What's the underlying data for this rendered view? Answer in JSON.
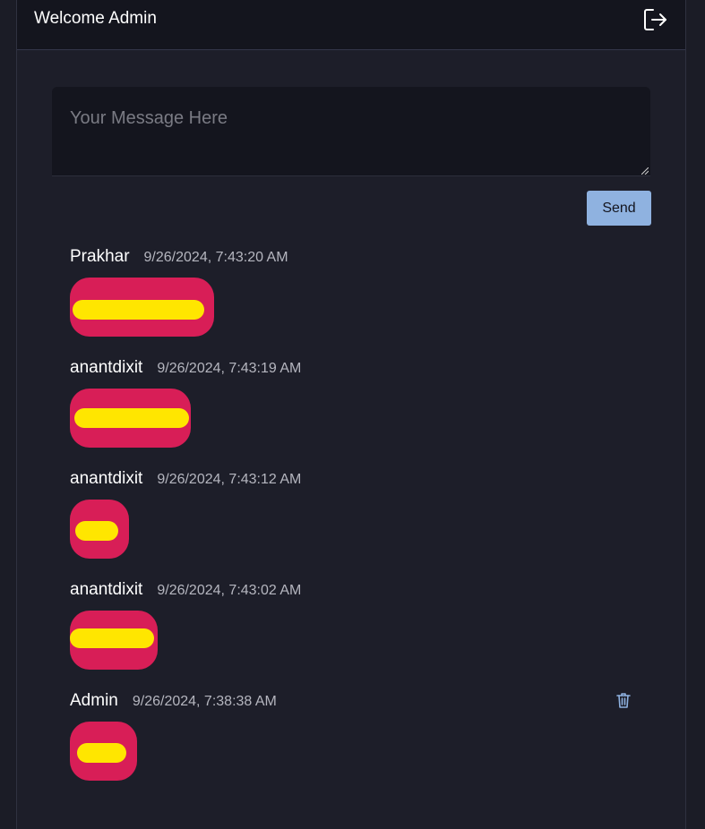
{
  "header": {
    "title": "Welcome Admin",
    "logout_icon": "logout-icon"
  },
  "composer": {
    "placeholder": "Your Message Here",
    "value": "",
    "send_label": "Send"
  },
  "messages": [
    {
      "user": "Prakhar",
      "time": "9/26/2024, 7:43:20 AM",
      "text": "",
      "deletable": false
    },
    {
      "user": "anantdixit",
      "time": "9/26/2024, 7:43:19 AM",
      "text": "",
      "deletable": false
    },
    {
      "user": "anantdixit",
      "time": "9/26/2024, 7:43:12 AM",
      "text": "",
      "deletable": false
    },
    {
      "user": "anantdixit",
      "time": "9/26/2024, 7:43:02 AM",
      "text": "",
      "deletable": false
    },
    {
      "user": "Admin",
      "time": "9/26/2024, 7:38:38 AM",
      "text": "",
      "deletable": true,
      "delete_icon": "trash-icon"
    }
  ],
  "colors": {
    "background": "#1d1e29",
    "header_bg": "#14151e",
    "bubble": "#d81e57",
    "send_button": "#8fb2e0",
    "redaction": "#ffe600"
  }
}
